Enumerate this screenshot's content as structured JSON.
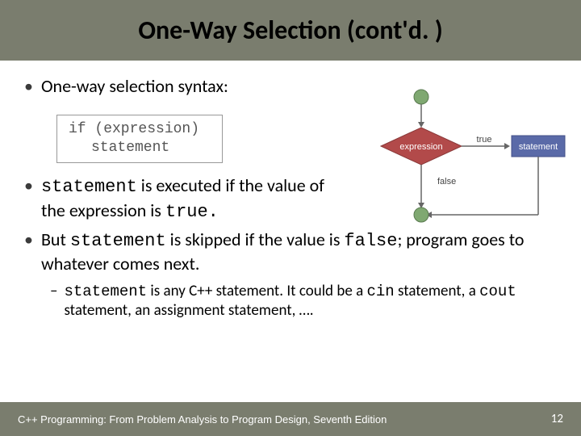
{
  "title": "One-Way Selection  (cont'd. )",
  "bullets": {
    "b1": "One-way selection syntax:",
    "code_line1": "if (expression)",
    "code_line2": "statement",
    "b2_pre": "statement",
    "b2_mid": " is executed if the value of the expression is ",
    "b2_code2": "true.",
    "b3_pre": "But ",
    "b3_code": "statement",
    "b3_mid": " is skipped if the value is ",
    "b3_code2": "false",
    "b3_post": "; program goes to whatever comes next.",
    "sub_code1": "statement",
    "sub_mid1": " is any C++ statement.  It could be a ",
    "sub_code2": "cin",
    "sub_mid2": " statement, a ",
    "sub_code3": "cout",
    "sub_post": " statement, an assignment statement, …."
  },
  "flowchart": {
    "expression": "expression",
    "true": "true",
    "false": "false",
    "statement": "statement"
  },
  "footer": {
    "text": "C++ Programming: From Problem Analysis to Program Design, Seventh Edition",
    "page": "12"
  }
}
